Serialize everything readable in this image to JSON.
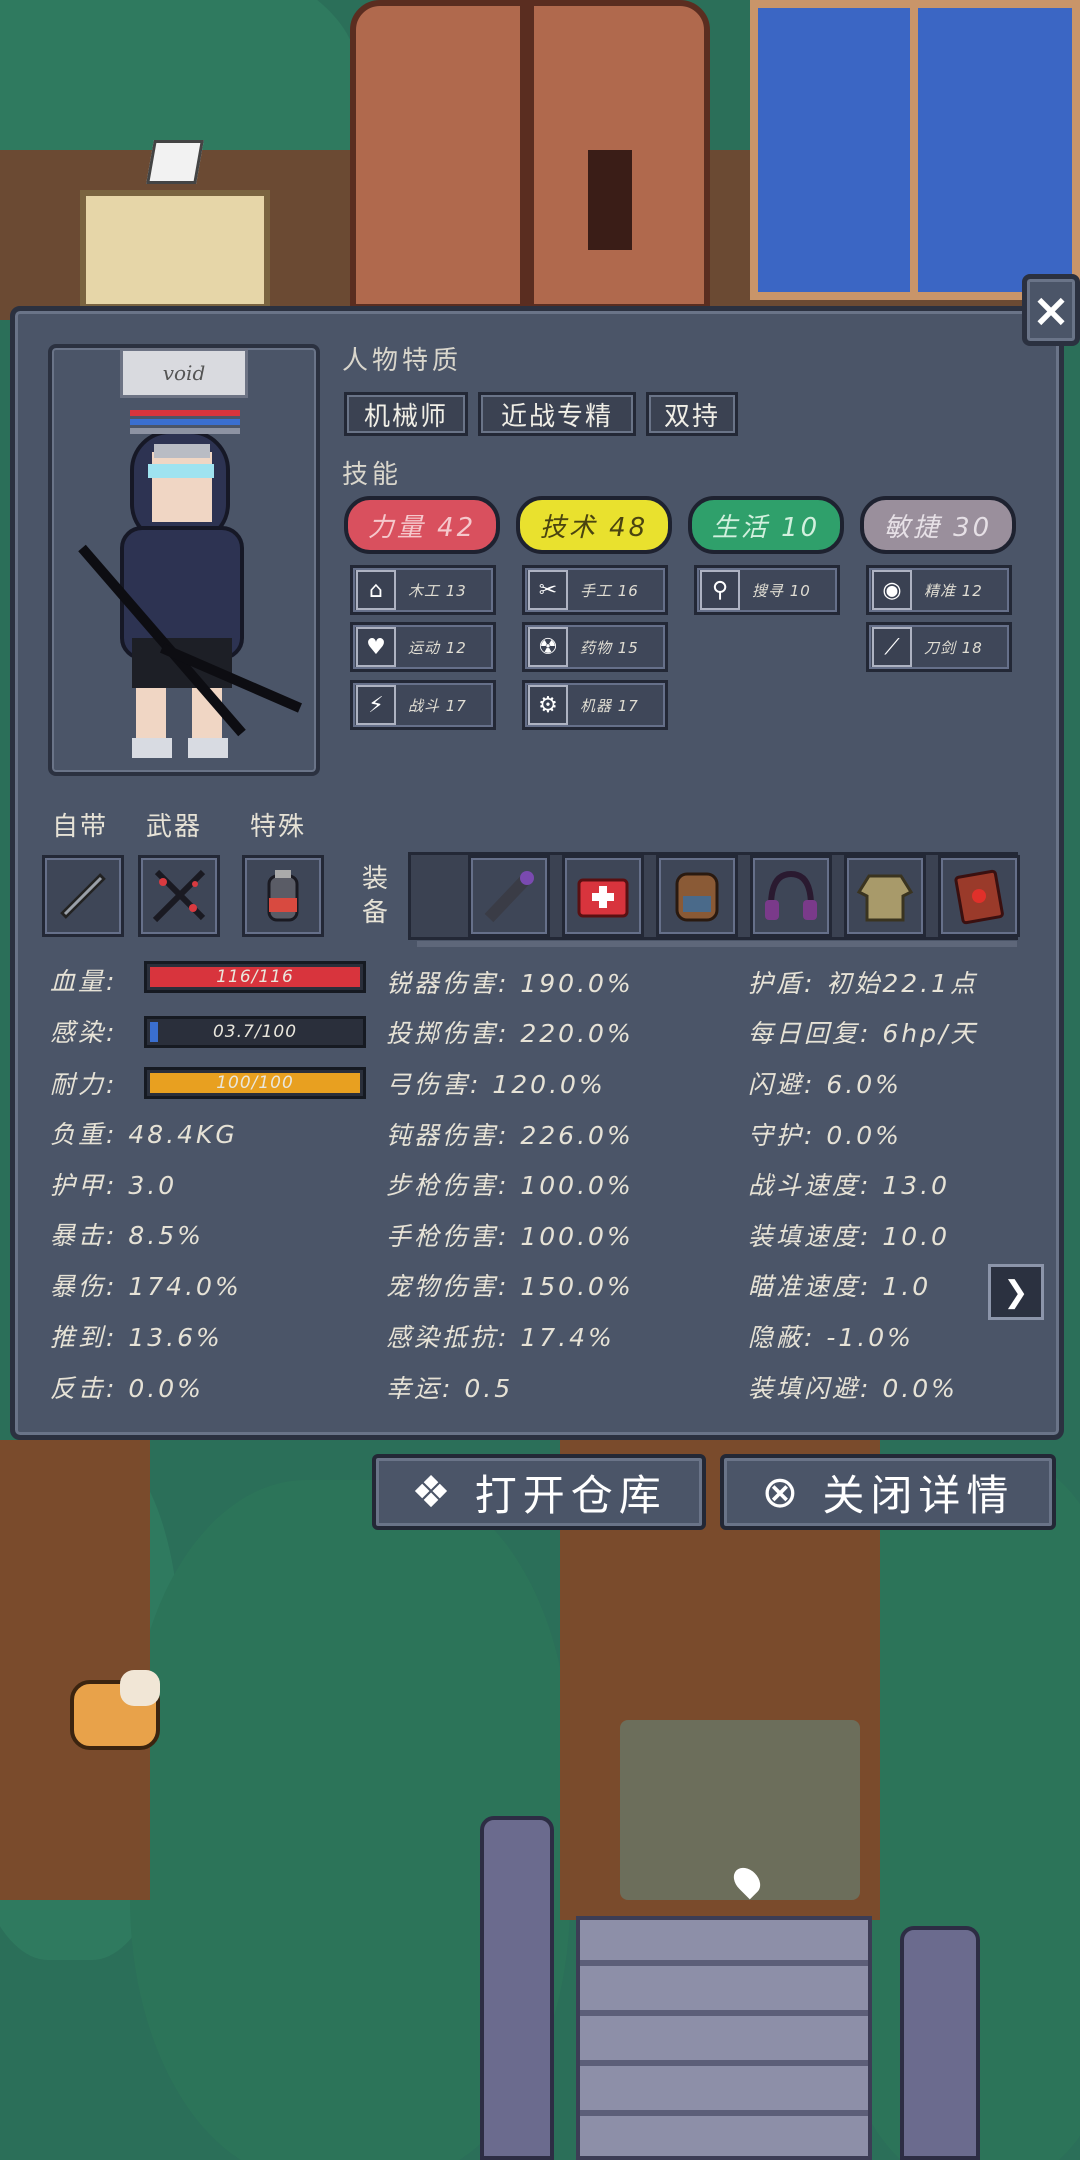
{
  "character": {
    "name": "void"
  },
  "close": {
    "label": "×"
  },
  "traits": {
    "title": "人物特质",
    "items": [
      "机械师",
      "近战专精",
      "双持"
    ]
  },
  "skills": {
    "title": "技能",
    "main": [
      {
        "label": "力量 42",
        "color": "#d9505e"
      },
      {
        "label": "技术 48",
        "color": "#e9e12e"
      },
      {
        "label": "生活 10",
        "color": "#2fa06b"
      },
      {
        "label": "敏捷 30",
        "color": "#9a8f9c"
      }
    ],
    "sub": [
      {
        "icon": "house-icon",
        "glyph": "⌂",
        "label": "木工 13"
      },
      {
        "icon": "heart-icon",
        "glyph": "♥",
        "label": "运动 12"
      },
      {
        "icon": "lightning-fist-icon",
        "glyph": "⚡",
        "label": "战斗 17"
      },
      {
        "icon": "scissors-icon",
        "glyph": "✂",
        "label": "手工 16"
      },
      {
        "icon": "radiation-icon",
        "glyph": "☢",
        "label": "药物 15"
      },
      {
        "icon": "gear-icon",
        "glyph": "⚙",
        "label": "机器 17"
      },
      {
        "icon": "magnifier-icon",
        "glyph": "⚲",
        "label": "搜寻 10"
      },
      {
        "icon": "eye-icon",
        "glyph": "◉",
        "label": "精准 12"
      },
      {
        "icon": "blade-icon",
        "glyph": "⟋",
        "label": "刀剑 18"
      }
    ]
  },
  "slots": {
    "self": "自带",
    "weapon": "武器",
    "special": "特殊",
    "equip": "装备"
  },
  "equipment": [
    "flashlight-icon",
    "medkit-icon",
    "backpack-icon",
    "headphones-icon",
    "jacket-icon",
    "book-icon"
  ],
  "bars": {
    "hp": {
      "label": "血量:",
      "text": "116/116",
      "fraction": 1.0,
      "color": "#d8343d"
    },
    "infection": {
      "label": "感染:",
      "text": "03.7/100",
      "fraction": 0.037,
      "color": "#3a6fd0"
    },
    "stamina": {
      "label": "耐力:",
      "text": "100/100",
      "fraction": 1.0,
      "color": "#e8a020"
    }
  },
  "stats_left": [
    "负重: 48.4KG",
    "护甲: 3.0",
    "暴击: 8.5%",
    "暴伤: 174.0%",
    "推到: 13.6%",
    "反击: 0.0%"
  ],
  "stats_mid": [
    "锐器伤害: 190.0%",
    "投掷伤害: 220.0%",
    "弓伤害: 120.0%",
    "钝器伤害: 226.0%",
    "步枪伤害: 100.0%",
    "手枪伤害: 100.0%",
    "宠物伤害: 150.0%",
    "感染抵抗: 17.4%",
    "幸运: 0.5"
  ],
  "stats_right": [
    "护盾: 初始22.1点",
    "每日回复: 6hp/天",
    "闪避: 6.0%",
    "守护: 0.0%",
    "战斗速度: 13.0",
    "装填速度: 10.0",
    "瞄准速度: 1.0",
    "隐蔽: -1.0%",
    "装填闪避: 0.0%"
  ],
  "buttons": {
    "open_storage": {
      "label": "打开仓库",
      "icon": "storage-icon"
    },
    "close_detail": {
      "label": "关闭详情",
      "icon": "close-circle-icon"
    }
  }
}
